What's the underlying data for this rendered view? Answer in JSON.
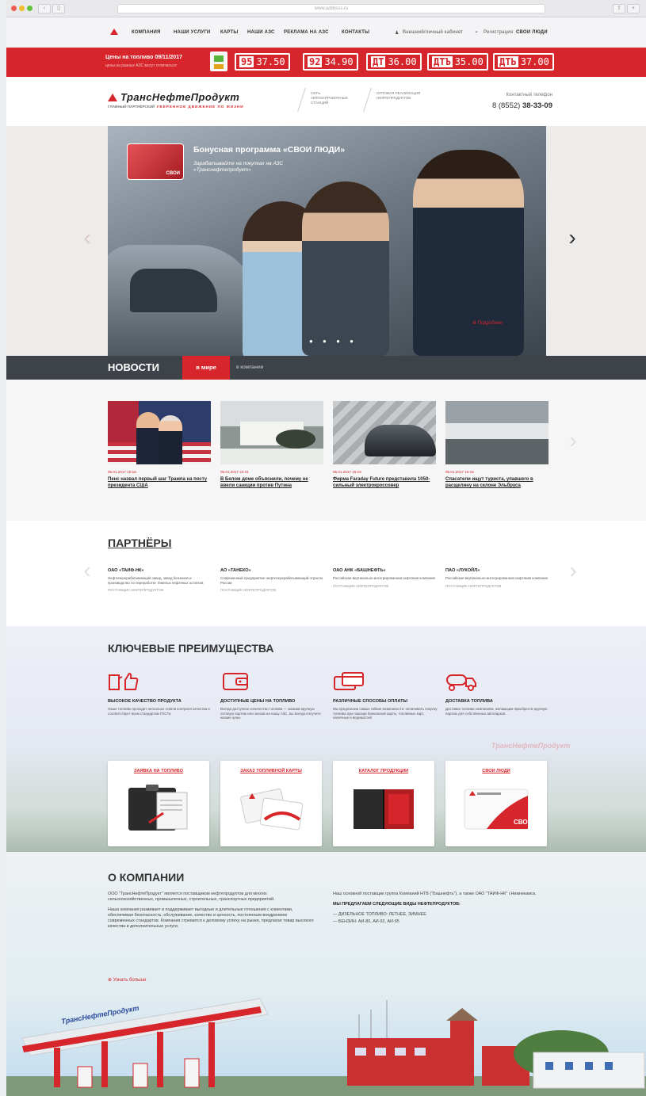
{
  "browser": {
    "address": "www.address.ru"
  },
  "nav": {
    "items": [
      "КОМПАНИЯ",
      "НАШИ УСЛУГИ",
      "КАРТЫ",
      "НАШИ АЗС",
      "РЕКЛАМА НА АЗС",
      "КОНТАКТЫ"
    ],
    "cabinet": "Внешний/личный кабинет",
    "program_prefix": "Регистрация",
    "program": "СВОИ ЛЮДИ"
  },
  "prices": {
    "title": "Цены на топливо 09/11/2017",
    "note": "цены на разных АЗС могут отличаться",
    "items": [
      {
        "grade": "95",
        "price": "37.50"
      },
      {
        "grade": "92",
        "price": "34.90"
      },
      {
        "grade": "ДТ",
        "price": "36.00"
      },
      {
        "grade": "ДТЪ",
        "price": "35.00"
      },
      {
        "grade": "ДТЬ",
        "price": "37.00"
      }
    ]
  },
  "header": {
    "brand": "ТрансНефтеПродукт",
    "slogan": "уверенное движение по жизни",
    "slogan_prefix": "главный партнёрский",
    "info1": "Сеть автозаправочных станций",
    "info2": "Оптовая реализация нефтепродуктов",
    "phone_label": "Контактный телефон",
    "phone_prefix": "8 (8552)",
    "phone_number": "38-33-09"
  },
  "hero": {
    "title": "Бонусная программа «СВОИ ЛЮДИ»",
    "subtitle": "Зарабатывайте на покупках на АЗС «Транснефтепродукт»",
    "card_label": "СВОИ",
    "more": "Подробнее",
    "dots": "● ● ● ●"
  },
  "news": {
    "title": "НОВОСТИ",
    "tab_active": "в мире",
    "tab_inactive": "в компании",
    "items": [
      {
        "date": "05.01.2017 15:16",
        "title": "Пенс назвал первый шаг Трампа на посту президента США"
      },
      {
        "date": "05.01.2017 22:41",
        "title": "В Белом доме объяснили, почему не ввели санкции против Путина"
      },
      {
        "date": "05.01.2017 15:16",
        "title": "Фирма Faraday Future представила 1050-сильный электрокроссовер"
      },
      {
        "date": "05.01.2017 15:16",
        "title": "Спасатели ищут туриста, упавшего в расщелину на склоне Эльбруса"
      }
    ]
  },
  "partners": {
    "title": "ПАРТНЁРЫ",
    "items": [
      {
        "name": "ОАО «ТАИФ-НК»",
        "desc": "Нефтеперерабатывающий завод, завод бензинов и производство по переработке тяжелых нефтяных остатков",
        "cat": "Поставщик нефтепродуктов"
      },
      {
        "name": "АО «ТАНЕКО»",
        "desc": "Современный предприятие нефтеперерабатывающий отрасли России",
        "cat": "Поставщик нефтепродуктов"
      },
      {
        "name": "ОАО АНК «БАШНЕФТЬ»",
        "desc": "Российская вертикально-интегрированная нефтяная компания",
        "cat": "Поставщик нефтепродуктов"
      },
      {
        "name": "ПАО «ЛУКОЙЛ»",
        "desc": "Российская вертикально-интегрированная нефтяная компания",
        "cat": "Поставщик нефтепродуктов"
      }
    ]
  },
  "advantages": {
    "title": "КЛЮЧЕВЫЕ ПРЕИМУЩЕСТВА",
    "items": [
      {
        "icon": "fuel-thumbs-up-icon",
        "title": "Высокое качество продукта",
        "desc": "Наше топливо проходит несколько этапов контроля качества и соответствует всем стандартам ГОСТа"
      },
      {
        "icon": "wallet-icon",
        "title": "Доступные цены на топливо",
        "desc": "Всегда доступное количество топлива — заказав крупную оптовую партию или заехав на нашу АЗС, вы всегда получите низкие цены"
      },
      {
        "icon": "payment-cards-icon",
        "title": "Различные способы оплаты",
        "desc": "Мы предлагаем самые гибкие возможности: оплачивать покупку топлива при помощи банковской карты, топливных карт, наличных и ведомостей"
      },
      {
        "icon": "fuel-truck-icon",
        "title": "Доставка топлива",
        "desc": "Доставка топлива компаниям, желающим приобрести крупную партию для собственных автопарков"
      }
    ],
    "watermark": "ТрансНефтеПродукт",
    "tiles": [
      {
        "title": "Заявка на топливо",
        "icon": "clipboard-icon"
      },
      {
        "title": "Заказ топливной карты",
        "icon": "fuel-card-icon"
      },
      {
        "title": "Каталог продукции",
        "icon": "catalog-icon"
      },
      {
        "title": "Свои люди",
        "icon": "loyalty-card-icon",
        "card_text": "СВОИ"
      }
    ]
  },
  "about": {
    "title": "О КОМПАНИИ",
    "p1": "ООО \"ТрансНефтеПродукт\" является поставщиком нефтепродуктов для многих сельскохозяйственных, промышленных, строительных, транспортных предприятий.",
    "p2": "Наша компания развивает и поддерживает выгодные и длительные отношения с клиентами, обеспечивая безопасность, обслуживание, качество и ценность, постоянным внедрением современных стандартов. Компания стремится к деловому успеху на рынке, предлагая товар высокого качества и дополнительные услуги.",
    "p3": "Наш основной поставщик группа Компаний НТВ (\"Башнефть\"), а также ОАО \"ТАИФ-НК\" г.Нижнекамск.",
    "offer_title": "Мы предлагаем следующие виды нефтепродуктов:",
    "offers": [
      "— ДИЗЕЛЬНОЕ ТОПЛИВО: ЛЕТНЕЕ, ЗИМНЕЕ",
      "— БЕНЗИН: АИ-80, АИ-92, АИ-95"
    ],
    "more": "Узнать больше",
    "station_sign": "ТрансНефтеПродукт"
  },
  "colors": {
    "accent": "#d6262b",
    "dark": "#3e4349"
  }
}
